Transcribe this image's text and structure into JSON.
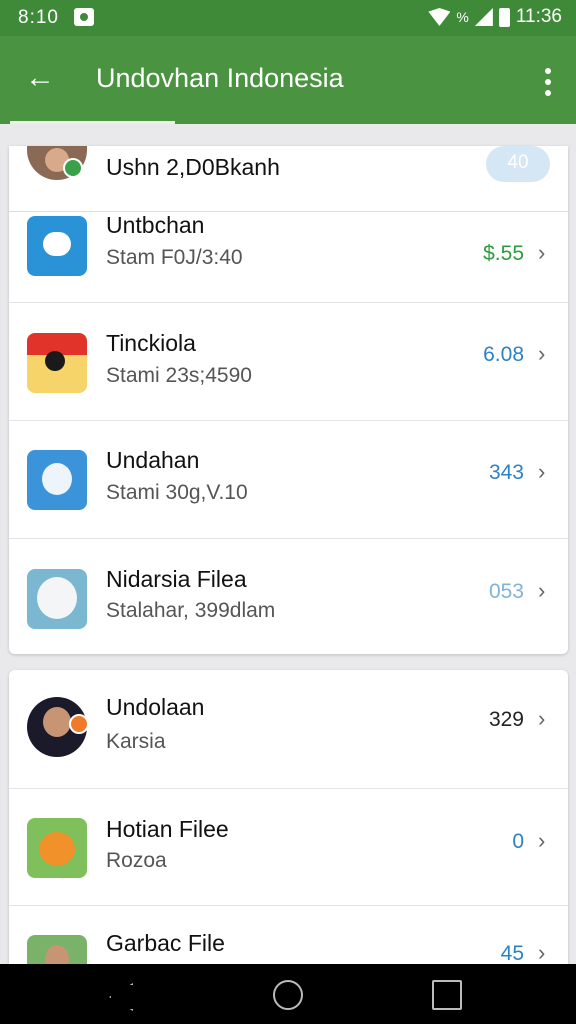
{
  "status": {
    "time": "8:10",
    "signal_text": "%",
    "clock": "11:36"
  },
  "app_bar": {
    "title": "Undovhan Indonesia"
  },
  "top_item": {
    "title": "Ushn 2,D0Bkanh",
    "badge": "40"
  },
  "list1": [
    {
      "title": "Untbchan",
      "subtitle": "Stam F0J/3:40",
      "value": "$.55",
      "value_color": "#2e9b3e",
      "icon": "chat-app-icon"
    },
    {
      "title": "Tinckiola",
      "subtitle": "Stami 23s;4590",
      "value": "6.08",
      "value_color": "#2d82c4",
      "icon": "photo-app-icon"
    },
    {
      "title": "Undahan",
      "subtitle": "Stami 30g,V.10",
      "value": "343",
      "value_color": "#2d82c4",
      "icon": "ghost-app-icon"
    },
    {
      "title": "Nidarsia Filea",
      "subtitle": "Stalahar, 399dlam",
      "value": "053",
      "value_color": "#7fb3d8",
      "icon": "smiley-app-icon"
    }
  ],
  "list2": [
    {
      "title": "Undolaan",
      "subtitle": "Karsia",
      "value": "329",
      "value_color": "#222222",
      "icon": "person-avatar-icon"
    },
    {
      "title": "Hotian Filee",
      "subtitle": "Rozoa",
      "value": "0",
      "value_color": "#2d82c4",
      "icon": "orange-app-icon"
    },
    {
      "title": "Garbac File",
      "subtitle": "",
      "value": "45",
      "value_color": "#2d82c4",
      "icon": "person-thumb-icon"
    }
  ],
  "chevron": "›"
}
